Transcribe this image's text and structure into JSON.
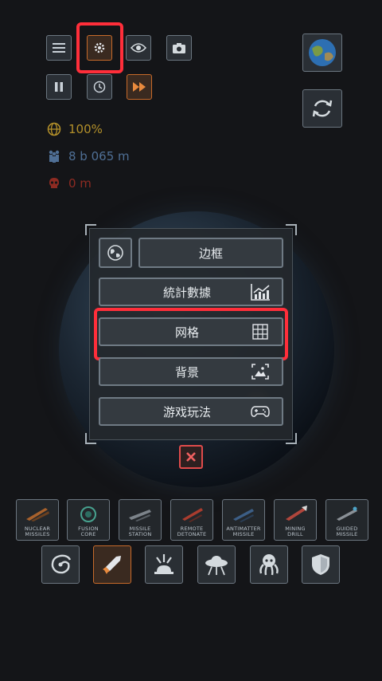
{
  "stats": {
    "habitability": "100%",
    "population": "8 b 065 m",
    "deaths": "0 m"
  },
  "menu": {
    "border_label": "边框",
    "statistics_label": "統計數據",
    "grid_label": "网格",
    "background_label": "背景",
    "gameplay_label": "游戏玩法"
  },
  "weapons": [
    {
      "line1": "NUCLEAR",
      "line2": "MISSILES"
    },
    {
      "line1": "FUSION",
      "line2": "CORE"
    },
    {
      "line1": "MISSILE",
      "line2": "STATION"
    },
    {
      "line1": "REMOTE",
      "line2": "DETONATE"
    },
    {
      "line1": "ANTIMATTER",
      "line2": "MISSILE"
    },
    {
      "line1": "MINING",
      "line2": "DRILL"
    },
    {
      "line1": "GUIDED",
      "line2": "MISSILE"
    }
  ],
  "colors": {
    "highlight": "#ff2e3a",
    "accent_orange": "#c76a2a",
    "stat_yellow": "#b3902a",
    "stat_blue": "#4f6f95",
    "stat_red": "#8e2b22"
  }
}
